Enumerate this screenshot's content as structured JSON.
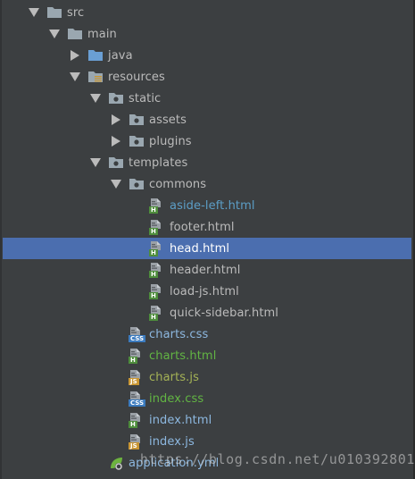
{
  "tree": {
    "nodes": [
      {
        "label": "src",
        "icon": "folder-icon",
        "expanded": true,
        "color": "#bbbbbb"
      },
      {
        "label": "main",
        "icon": "folder-icon",
        "expanded": true,
        "color": "#bbbbbb"
      },
      {
        "label": "java",
        "icon": "source-folder-icon",
        "expanded": false,
        "color": "#bbbbbb"
      },
      {
        "label": "resources",
        "icon": "resources-folder-icon",
        "expanded": true,
        "color": "#bbbbbb"
      },
      {
        "label": "static",
        "icon": "package-folder-icon",
        "expanded": true,
        "color": "#bbbbbb"
      },
      {
        "label": "assets",
        "icon": "package-folder-icon",
        "expanded": false,
        "color": "#bbbbbb"
      },
      {
        "label": "plugins",
        "icon": "package-folder-icon",
        "expanded": false,
        "color": "#bbbbbb"
      },
      {
        "label": "templates",
        "icon": "package-folder-icon",
        "expanded": true,
        "color": "#bbbbbb"
      },
      {
        "label": "commons",
        "icon": "package-folder-icon",
        "expanded": true,
        "color": "#bbbbbb"
      },
      {
        "label": "aside-left.html",
        "icon": "html-file-icon",
        "color": "#5c9ec7"
      },
      {
        "label": "footer.html",
        "icon": "html-file-icon",
        "color": "#bbbbbb"
      },
      {
        "label": "head.html",
        "icon": "html-file-icon",
        "color": "#ffffff",
        "selected": true
      },
      {
        "label": "header.html",
        "icon": "html-file-icon",
        "color": "#bbbbbb"
      },
      {
        "label": "load-js.html",
        "icon": "html-file-icon",
        "color": "#bbbbbb"
      },
      {
        "label": "quick-sidebar.html",
        "icon": "html-file-icon",
        "color": "#bbbbbb"
      },
      {
        "label": "charts.css",
        "icon": "css-file-icon",
        "color": "#8db8e0"
      },
      {
        "label": "charts.html",
        "icon": "html-file-icon",
        "color": "#62b543"
      },
      {
        "label": "charts.js",
        "icon": "js-file-icon",
        "color": "#a5b356"
      },
      {
        "label": "index.css",
        "icon": "css-file-icon",
        "color": "#62b543"
      },
      {
        "label": "index.html",
        "icon": "html-file-icon",
        "color": "#8db8e0"
      },
      {
        "label": "index.js",
        "icon": "js-file-icon",
        "color": "#8db8e0"
      },
      {
        "label": "application.yml",
        "icon": "spring-config-icon",
        "color": "#8db8e0"
      }
    ]
  },
  "badges": {
    "html": "H",
    "css": "CSS",
    "js": "JS"
  },
  "watermark": "https://blog.csdn.net/u010392801",
  "colors": {
    "background": "#3c3f41",
    "selection": "#4b6eaf",
    "folder": "#9aa7b0",
    "html_badge": "#4e8d3c",
    "css_badge": "#3b7bbf",
    "js_badge": "#c99633",
    "source_folder": "#6a9fd4"
  }
}
